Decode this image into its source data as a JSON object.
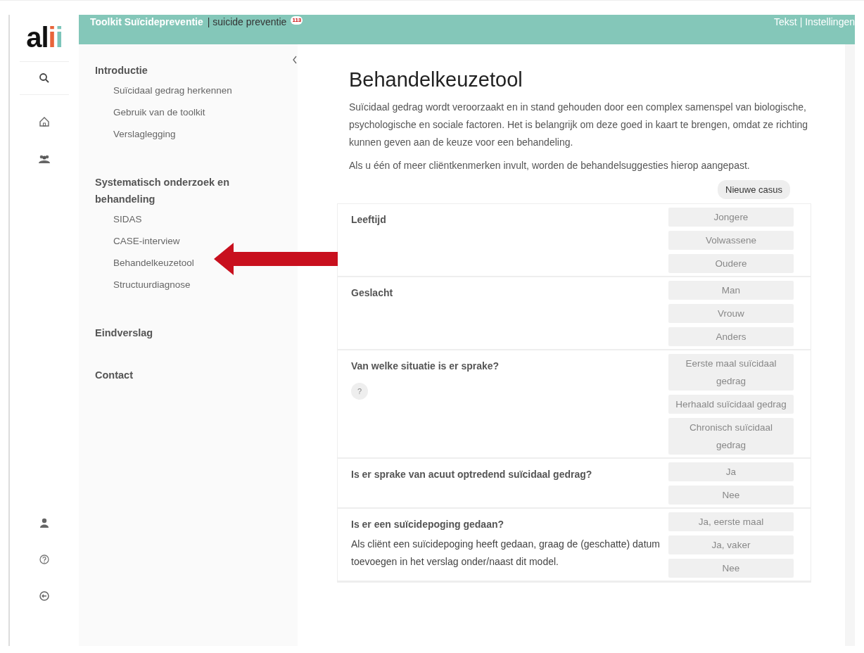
{
  "logo": "alii",
  "header": {
    "title": "Toolkit Suïcidepreventie",
    "subtitle": "| suicide preventie",
    "badge": "113",
    "links": "Tekst | Instellingen"
  },
  "sidebar": {
    "sections": [
      {
        "label": "Introductie",
        "children": [
          {
            "label": "Suïcidaal gedrag herkennen"
          },
          {
            "label": "Gebruik van de toolkit"
          },
          {
            "label": "Verslaglegging"
          }
        ]
      },
      {
        "label": "Systematisch onderzoek en behandeling",
        "children": [
          {
            "label": "SIDAS"
          },
          {
            "label": "CASE-interview"
          },
          {
            "label": "Behandelkeuzetool"
          },
          {
            "label": "Structuurdiagnose"
          }
        ]
      },
      {
        "label": "Eindverslag"
      },
      {
        "label": "Contact"
      }
    ]
  },
  "main": {
    "title": "Behandelkeuzetool",
    "intro": [
      "Suïcidaal gedrag wordt veroorzaakt en in stand gehouden door een complex samenspel van biologische, psychologische en sociale factoren. Het is belangrijk om deze goed in kaart te brengen, omdat ze richting kunnen geven aan de keuze voor een behandeling.",
      "Als u één of meer cliëntkenmerken invult, worden de behandelsuggesties hierop aangepast."
    ],
    "new_case_button": "Nieuwe casus",
    "questions": [
      {
        "label": "Leeftijd",
        "options": [
          {
            "label": "Jongere",
            "selected": false
          },
          {
            "label": "Volwassene",
            "selected": false
          },
          {
            "label": "Oudere",
            "selected": false
          }
        ]
      },
      {
        "label": "Geslacht",
        "options": [
          {
            "label": "Man",
            "selected": false
          },
          {
            "label": "Vrouw",
            "selected": false
          },
          {
            "label": "Anders",
            "selected": false
          }
        ]
      },
      {
        "label": "Van welke situatie is er sprake?",
        "help": "?",
        "options": [
          {
            "label": "Eerste maal suïcidaal gedrag",
            "selected": false
          },
          {
            "label": "Herhaald suïcidaal gedrag",
            "selected": false
          },
          {
            "label": "Chronisch suïcidaal gedrag",
            "selected": false
          }
        ]
      },
      {
        "label": "Is er sprake van acuut optredend suïcidaal gedrag?",
        "options": [
          {
            "label": "Ja",
            "selected": false
          },
          {
            "label": "Nee",
            "selected": false
          }
        ]
      },
      {
        "label": "Is er een suïcidepoging gedaan?",
        "note": "Als cliënt een suïcidepoging heeft gedaan, graag de (geschatte) datum toevoegen in het verslag onder/naast dit model.",
        "options": [
          {
            "label": "Ja, eerste maal",
            "selected": false
          },
          {
            "label": "Ja, vaker",
            "selected": false
          },
          {
            "label": "Nee",
            "selected": false
          }
        ]
      }
    ]
  }
}
